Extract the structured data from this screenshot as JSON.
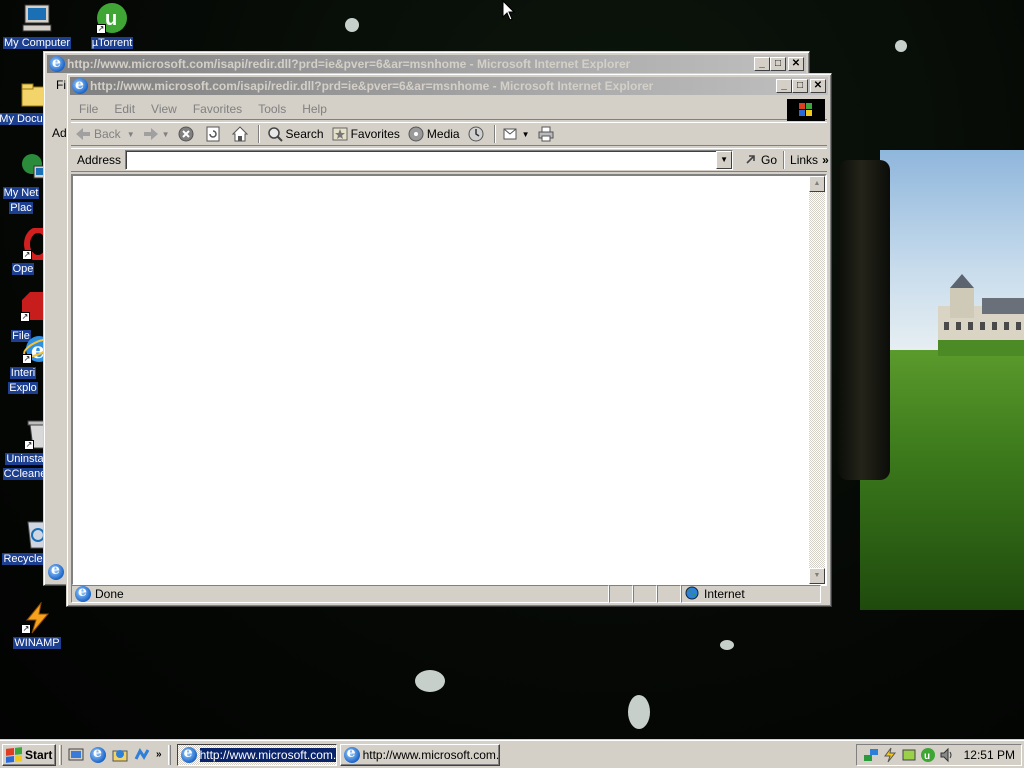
{
  "desktop": {
    "icons": [
      {
        "label": "My Computer"
      },
      {
        "label": "µTorrent"
      },
      {
        "label": "My Docu"
      },
      {
        "label": "My Net",
        "label2": "Plac"
      },
      {
        "label": "Ope"
      },
      {
        "label": "File"
      },
      {
        "label": "Interi",
        "label2": "Explo"
      },
      {
        "label": "Uninsta",
        "label2": "CCleane"
      },
      {
        "label": "Recycle"
      },
      {
        "label": "WINAMP"
      }
    ]
  },
  "back_window": {
    "title": "http://www.microsoft.com/isapi/redir.dll?prd=ie&pver=6&ar=msnhome - Microsoft Internet Explorer",
    "menu_peek": "Fi",
    "addr_peek": "Ad"
  },
  "ie": {
    "title": "http://www.microsoft.com/isapi/redir.dll?prd=ie&pver=6&ar=msnhome - Microsoft Internet Explorer",
    "menu": [
      "File",
      "Edit",
      "View",
      "Favorites",
      "Tools",
      "Help"
    ],
    "toolbar": {
      "back": "Back",
      "search": "Search",
      "favorites": "Favorites",
      "media": "Media"
    },
    "address": {
      "label": "Address",
      "value": "",
      "go": "Go",
      "links": "Links"
    },
    "status": {
      "text": "Done",
      "zone": "Internet"
    }
  },
  "taskbar": {
    "start": "Start",
    "tasks": [
      {
        "label": "http://www.microsoft.com...",
        "active": true
      },
      {
        "label": "http://www.microsoft.com...",
        "active": false
      }
    ],
    "clock": "12:51 PM"
  },
  "colors": {
    "desktop_label_bg": "#1d3f8f",
    "window_face": "#d4d0c8",
    "inactive_title_start": "#808080",
    "inactive_title_end": "#c0c0c0"
  }
}
